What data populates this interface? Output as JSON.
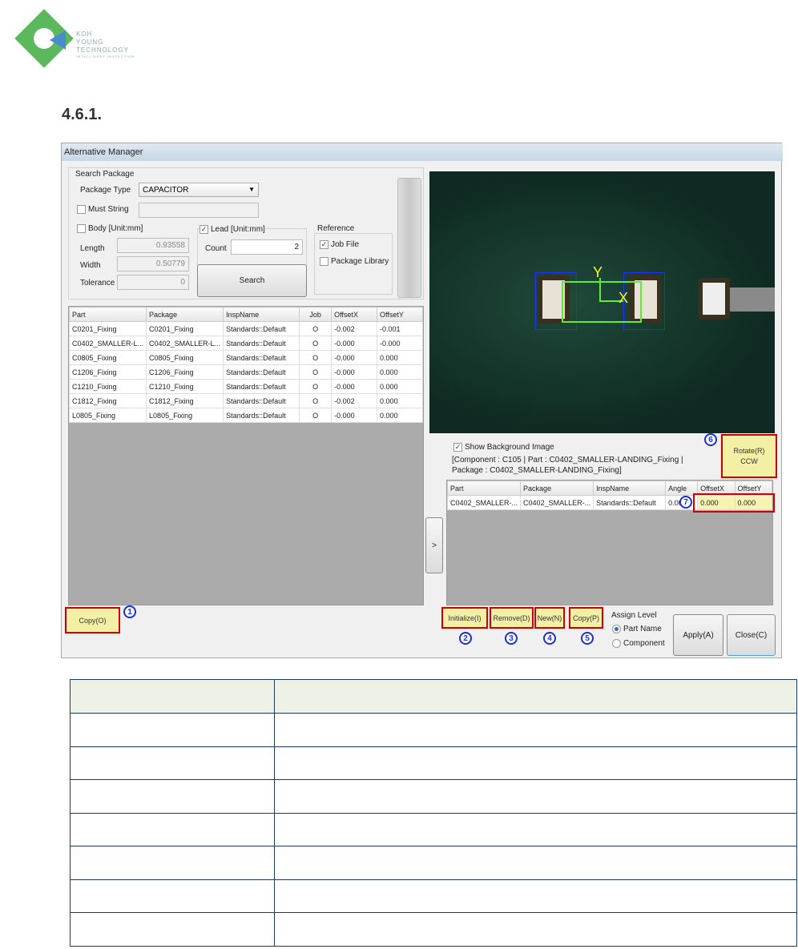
{
  "logo": {
    "line1": "KOH",
    "line2": "YOUNG",
    "line3": "TECHNOLOGY",
    "tagline": "INTELLIGENT INSPECTION",
    "colors": {
      "green": "#5cb85c",
      "blue": "#4a8bd0"
    }
  },
  "heading": "4.6.1.",
  "window": {
    "title": "Alternative Manager",
    "search": {
      "group_label": "Search Package",
      "package_type_label": "Package Type",
      "package_type_value": "CAPACITOR",
      "must_string_label": "Must String",
      "must_string_value": "",
      "body_label": "Body [Unit:mm]",
      "length_label": "Length",
      "length_value": "0.93558",
      "width_label": "Width",
      "width_value": "0.50779",
      "tolerance_label": "Tolerance",
      "tolerance_value": "0",
      "lead_label": "Lead [Unit:mm]",
      "count_label": "Count",
      "count_value": "2",
      "search_button": "Search",
      "reference_label": "Reference",
      "job_file_label": "Job File",
      "package_library_label": "Package Library"
    },
    "left_table": {
      "columns": [
        "Part",
        "Package",
        "InspName",
        "Job",
        "OffsetX",
        "OffsetY"
      ],
      "rows": [
        [
          "C0201_Fixing",
          "C0201_Fixing",
          "Standards::Default",
          "O",
          "-0.002",
          "-0.001"
        ],
        [
          "C0402_SMALLER-L...",
          "C0402_SMALLER-L...",
          "Standards::Default",
          "O",
          "-0.000",
          "-0.000"
        ],
        [
          "C0805_Fixing",
          "C0805_Fixing",
          "Standards::Default",
          "O",
          "-0.000",
          "0.000"
        ],
        [
          "C1206_Fixing",
          "C1206_Fixing",
          "Standards::Default",
          "O",
          "-0.000",
          "0.000"
        ],
        [
          "C1210_Fixing",
          "C1210_Fixing",
          "Standards::Default",
          "O",
          "-0.000",
          "0.000"
        ],
        [
          "C1812_Fixing",
          "C1812_Fixing",
          "Standards::Default",
          "O",
          "-0.002",
          "0.000"
        ],
        [
          "L0805_Fixing",
          "L0805_Fixing",
          "Standards::Default",
          "O",
          "-0.000",
          "0.000"
        ]
      ]
    },
    "copy_o_button": "Copy(O)",
    "image": {
      "axis_x": "X",
      "axis_y": "Y"
    },
    "expand_button": ">",
    "show_background_label": "Show Background Image",
    "info_text": "[Component : C105 | Part : C0402_SMALLER-LANDING_Fixing | Package : C0402_SMALLER-LANDING_Fixing]",
    "rotate_button_line1": "Rotate(R)",
    "rotate_button_line2": "CCW",
    "right_table": {
      "columns": [
        "Part",
        "Package",
        "InspName",
        "Angle",
        "OffsetX",
        "OffsetY"
      ],
      "rows": [
        [
          "C0402_SMALLER-...",
          "C0402_SMALLER-...",
          "Standards::Default",
          "0.00",
          "0.000",
          "0.000"
        ]
      ]
    },
    "buttons": {
      "initialize": "Initialize(I)",
      "remove": "Remove(D)",
      "new": "New(N)",
      "copy_p": "Copy(P)",
      "apply": "Apply(A)",
      "close": "Close(C)"
    },
    "assign_level": {
      "label": "Assign Level",
      "part_name": "Part Name",
      "component": "Component"
    },
    "callouts": [
      "1",
      "2",
      "3",
      "4",
      "5",
      "6",
      "7"
    ]
  }
}
